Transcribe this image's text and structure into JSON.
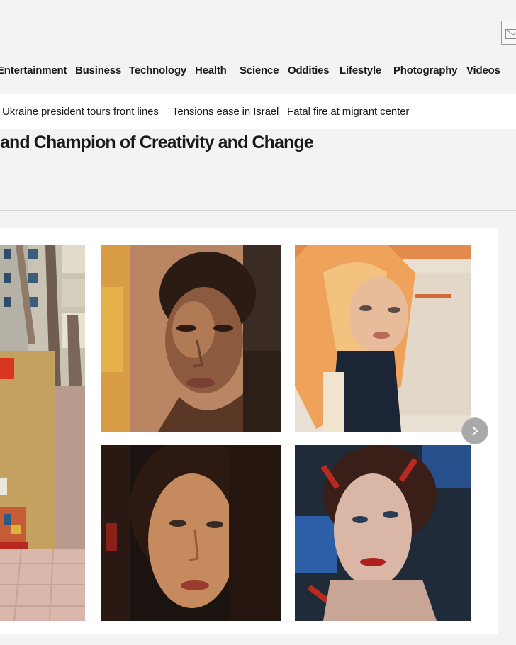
{
  "nav": {
    "items": [
      "Entertainment",
      "Business",
      "Technology",
      "Health",
      "Science",
      "Oddities",
      "Lifestyle",
      "Photography",
      "Videos"
    ]
  },
  "trending": {
    "items": [
      "Ukraine president tours front lines",
      "Tensions ease in Israel",
      "Fatal fire at migrant center"
    ]
  },
  "article": {
    "headline": "and Champion of Creativity and Change"
  },
  "icons": {
    "mail": "mail-icon",
    "next": "chevron-right-icon"
  },
  "gallery": {
    "images": [
      "street-mural-photo",
      "portrait-painting-dark-skin",
      "portrait-painting-blonde",
      "portrait-painting-brunette",
      "portrait-painting-red-lips"
    ]
  }
}
